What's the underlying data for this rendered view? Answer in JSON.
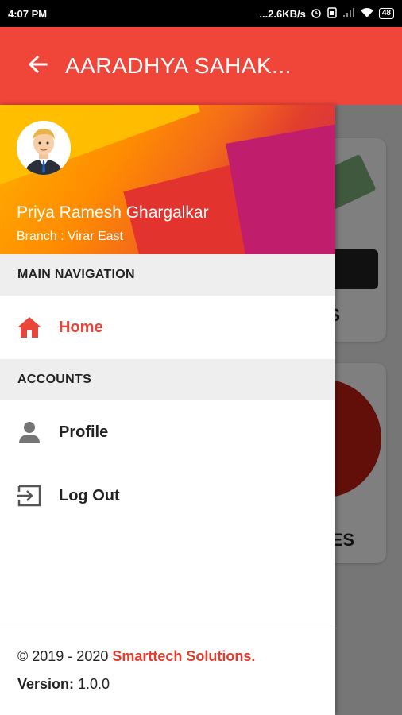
{
  "status_bar": {
    "time": "4:07 PM",
    "network_speed": "...2.6KB/s",
    "battery": "48",
    "icons": [
      "alarm-icon",
      "sim-icon",
      "signal-icon",
      "wifi-icon",
      "battery-icon"
    ]
  },
  "app_bar": {
    "title": "AARADHYA SAHAK...",
    "back_icon": "arrow-left-icon",
    "color": "#f0463a"
  },
  "background_cards": {
    "card1_label": "S",
    "card2_label": "ES"
  },
  "drawer": {
    "user_name": "Priya Ramesh Ghargalkar",
    "branch": "Branch : Virar East",
    "sections": [
      {
        "title": "MAIN NAVIGATION",
        "items": [
          {
            "label": "Home",
            "icon": "home-icon",
            "active": true
          }
        ]
      },
      {
        "title": "ACCOUNTS",
        "items": [
          {
            "label": "Profile",
            "icon": "person-icon",
            "active": false
          },
          {
            "label": "Log Out",
            "icon": "logout-icon",
            "active": false
          }
        ]
      }
    ],
    "footer": {
      "copyright_prefix": "© 2019 - 2020 ",
      "company": "Smarttech Solutions",
      "period": ".",
      "version_label": "Version:",
      "version_value": " 1.0.0"
    },
    "accent_color": "#e8463a"
  }
}
